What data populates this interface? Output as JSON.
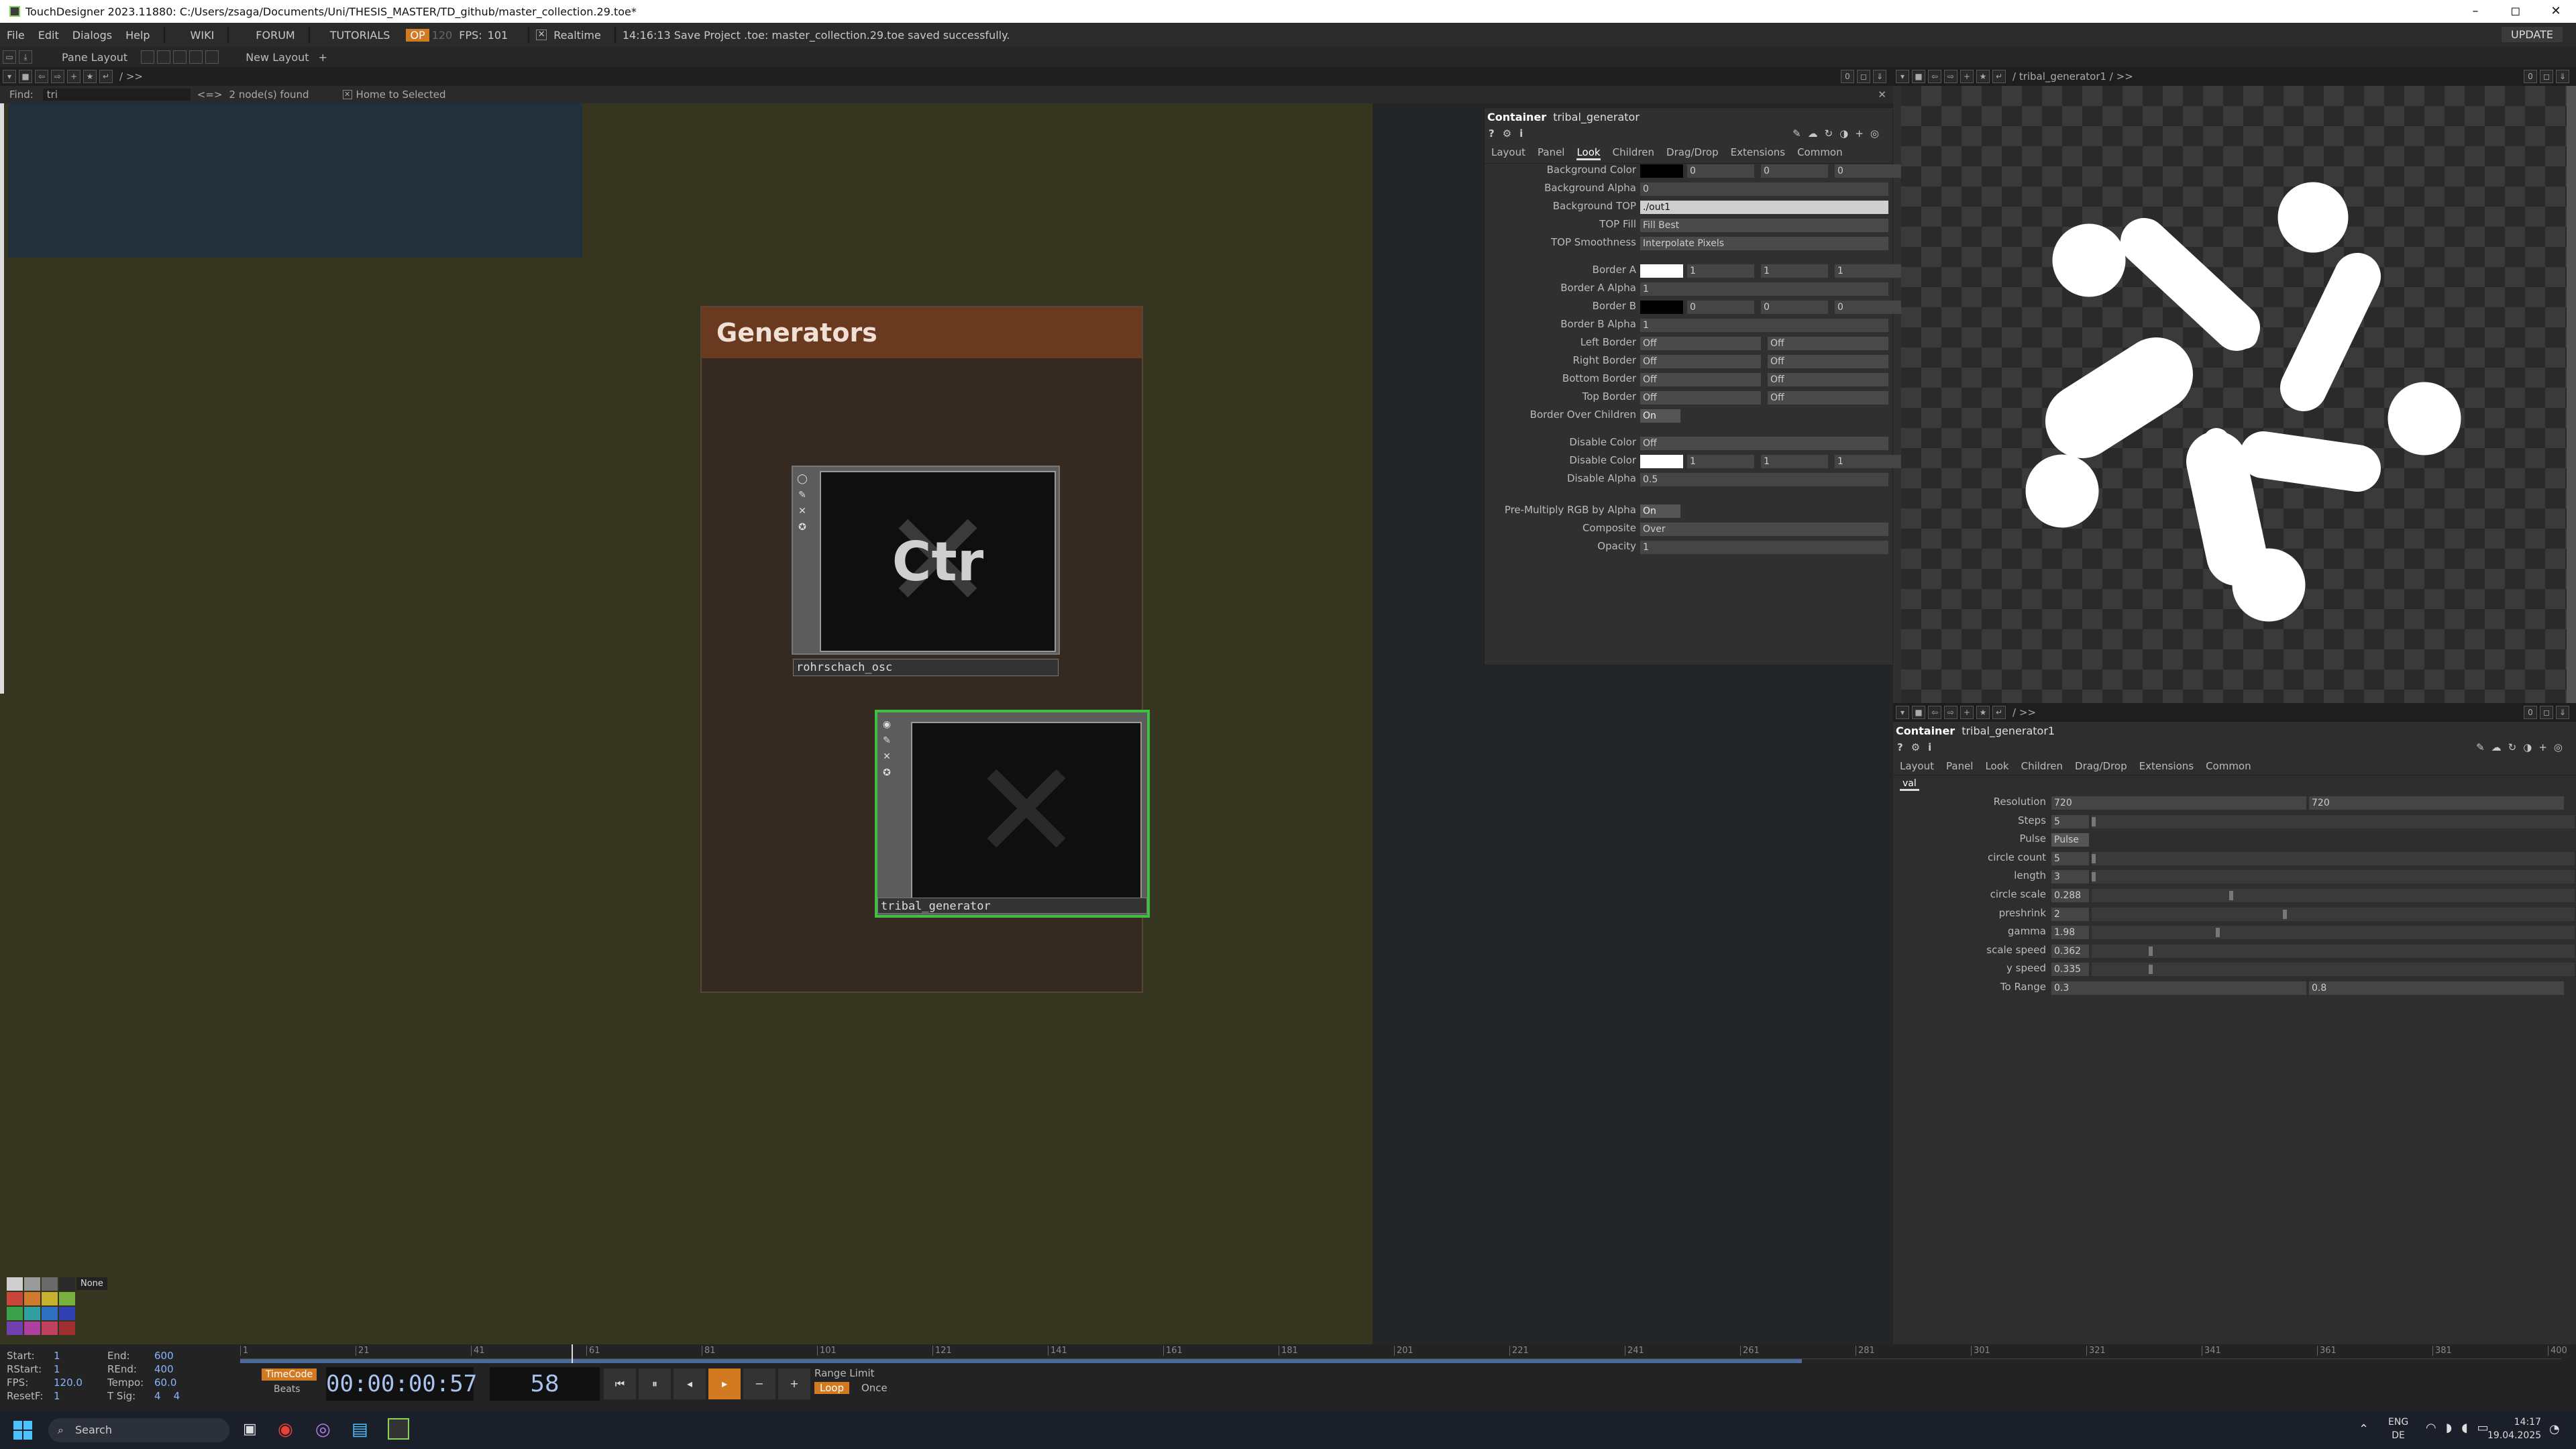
{
  "app": {
    "title": "TouchDesigner 2023.11880: C:/Users/zsaga/Documents/Uni/THESIS_MASTER/TD_github/master_collection.29.toe*",
    "window_controls": [
      "–",
      "◻",
      "✕"
    ]
  },
  "menu": {
    "items": [
      "File",
      "Edit",
      "Dialogs",
      "Help"
    ],
    "links": [
      "WIKI",
      "FORUM",
      "TUTORIALS"
    ],
    "perf": "OP",
    "grey": "120",
    "fps_label": "FPS:",
    "fps_value": "101",
    "realtime": "Realtime",
    "status": "14:16:13 Save Project .toe: master_collection.29.toe saved successfully.",
    "update": "UPDATE"
  },
  "layout_bar": {
    "pane_layout": "Pane Layout",
    "new_layout": "New Layout",
    "add": "+"
  },
  "network_path": "/ >>",
  "find": {
    "label": "Find:",
    "query": "tri",
    "arrows": "<=>",
    "result": "2 node(s) found",
    "home": "Home to Selected"
  },
  "network": {
    "container_title": "Generators",
    "nodes": [
      {
        "name": "rohrschach_osc",
        "thumb_text": "Ctr"
      },
      {
        "name": "tribal_generator",
        "thumb_text": ""
      }
    ]
  },
  "param_left": {
    "type": "Container",
    "name": "tribal_generator",
    "tabs": [
      "Layout",
      "Panel",
      "Look",
      "Children",
      "Drag/Drop",
      "Extensions",
      "Common"
    ],
    "active_tab": "Look",
    "rows": [
      {
        "label": "Background Color",
        "values": [
          "0",
          "0",
          "0"
        ],
        "swatch": "#000000"
      },
      {
        "label": "Background Alpha",
        "values": [
          "0"
        ]
      },
      {
        "label": "Background TOP",
        "values": [
          "./out1"
        ]
      },
      {
        "label": "TOP Fill",
        "values": [
          "Fill Best"
        ]
      },
      {
        "label": "TOP Smoothness",
        "values": [
          "Interpolate Pixels"
        ]
      },
      {
        "label": "Border A",
        "values": [
          "1",
          "1",
          "1"
        ],
        "swatch": "#ffffff"
      },
      {
        "label": "Border A Alpha",
        "values": [
          "1"
        ]
      },
      {
        "label": "Border B",
        "values": [
          "0",
          "0",
          "0"
        ],
        "swatch": "#000000"
      },
      {
        "label": "Border B Alpha",
        "values": [
          "1"
        ]
      },
      {
        "label": "Left Border",
        "values": [
          "Off",
          "Off"
        ]
      },
      {
        "label": "Right Border",
        "values": [
          "Off",
          "Off"
        ]
      },
      {
        "label": "Bottom Border",
        "values": [
          "Off",
          "Off"
        ]
      },
      {
        "label": "Top Border",
        "values": [
          "Off",
          "Off"
        ]
      },
      {
        "label": "Border Over Children",
        "values": [
          "On"
        ]
      },
      {
        "label": "Disable Color",
        "values": [
          "Off"
        ]
      },
      {
        "label": "Disable Color",
        "values": [
          "1",
          "1",
          "1"
        ],
        "swatch": "#ffffff"
      },
      {
        "label": "Disable Alpha",
        "values": [
          "0.5"
        ]
      },
      {
        "label": "Pre-Multiply RGB by Alpha",
        "values": [
          "On"
        ]
      },
      {
        "label": "Composite",
        "values": [
          "Over"
        ]
      },
      {
        "label": "Opacity",
        "values": [
          "1"
        ]
      }
    ]
  },
  "viewer": {
    "path": "/ tribal_generator1 / >>",
    "lower_path": "/ >>",
    "counter": "0"
  },
  "param_right": {
    "type": "Container",
    "name": "tribal_generator1",
    "tabs": [
      "Layout",
      "Panel",
      "Look",
      "Children",
      "Drag/Drop",
      "Extensions",
      "Common"
    ],
    "active_tab": "val",
    "rows": [
      {
        "label": "Resolution",
        "values": [
          "720",
          "720"
        ]
      },
      {
        "label": "Steps",
        "values": [
          "5"
        ],
        "slider": 0.0
      },
      {
        "label": "Pulse",
        "values": [
          "Pulse"
        ]
      },
      {
        "label": "circle count",
        "values": [
          "5"
        ],
        "slider": 0.0
      },
      {
        "label": "length",
        "values": [
          "3"
        ],
        "slider": 0.0
      },
      {
        "label": "circle scale",
        "values": [
          "0.288"
        ],
        "slider": 0.288
      },
      {
        "label": "preshrink",
        "values": [
          "2"
        ],
        "slider": 0.4
      },
      {
        "label": "gamma",
        "values": [
          "1.98"
        ],
        "slider": 0.26
      },
      {
        "label": "scale speed",
        "values": [
          "0.362"
        ],
        "slider": 0.12
      },
      {
        "label": "y speed",
        "values": [
          "0.335"
        ],
        "slider": 0.12
      },
      {
        "label": "To Range",
        "values": [
          "0.3",
          "0.8"
        ]
      }
    ]
  },
  "palette": {
    "none": "None",
    "colors": [
      "#cfcfcf",
      "#9a9a9a",
      "#6a6a6a",
      "#2a2a2a",
      "#c8473a",
      "#d07a30",
      "#c8b030",
      "#7ab040",
      "#3aa04a",
      "#30a0a0",
      "#3070c0",
      "#3040b0",
      "#7040b0",
      "#b040a0",
      "#c04060",
      "#a03030"
    ]
  },
  "timeline": {
    "start": "1",
    "end": "600",
    "rstart": "1",
    "rend": "400",
    "fps": "120.0",
    "tempo": "60.0",
    "resetf": "1",
    "tsig": [
      "4",
      "4"
    ],
    "labels": {
      "start": "Start:",
      "end": "End:",
      "rstart": "RStart:",
      "rend": "REnd:",
      "fps": "FPS:",
      "tempo": "Tempo:",
      "resetf": "ResetF:",
      "tsig": "T Sig:"
    },
    "timecode_btn": "TimeCode",
    "beats_btn": "Beats",
    "timecode": "00:00:00:57",
    "frame": "58",
    "range_limit": "Range Limit",
    "loop": "Loop",
    "once": "Once",
    "ticks": [
      "1",
      "21",
      "41",
      "61",
      "81",
      "101",
      "121",
      "141",
      "161",
      "181",
      "201",
      "221",
      "241",
      "261",
      "281",
      "301",
      "321",
      "341",
      "361",
      "381",
      "400"
    ]
  },
  "taskbar": {
    "search": "Search",
    "lang": "ENG",
    "region": "DE",
    "time": "14:17",
    "date": "19.04.2025"
  }
}
